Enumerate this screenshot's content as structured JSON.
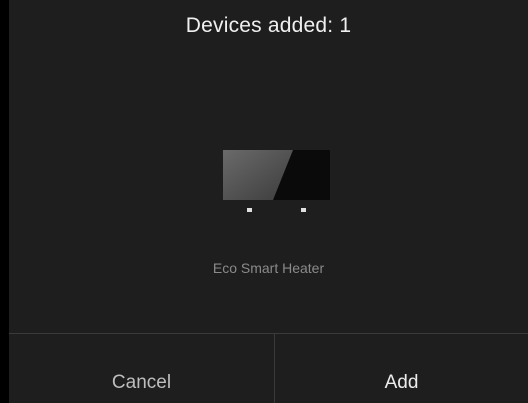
{
  "dialog": {
    "title": "Devices added: 1",
    "device": {
      "name": "Eco Smart Heater",
      "icon": "heater-icon"
    },
    "buttons": {
      "cancel_label": "Cancel",
      "add_label": "Add"
    }
  },
  "colors": {
    "background": "#1e1e1e",
    "title_text": "#f0f0f0",
    "muted_text": "#8a8a8a",
    "divider": "#3a3a3a"
  }
}
